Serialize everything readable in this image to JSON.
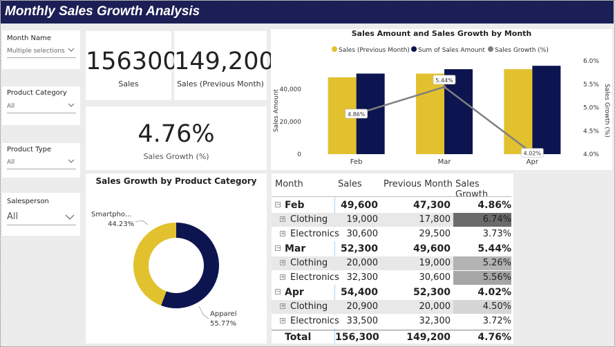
{
  "title": "Monthly Sales Growth Analysis",
  "slicers": [
    {
      "label": "Month Name",
      "value": "Multiple selections"
    },
    {
      "label": "Product Category",
      "value": "All"
    },
    {
      "label": "Product Type",
      "value": "All"
    },
    {
      "label": "Salesperson",
      "value": "All"
    }
  ],
  "kpis": {
    "sales": {
      "value": "156300",
      "label": "Sales"
    },
    "prev": {
      "value": "149,200",
      "label": "Sales (Previous Month)"
    },
    "growth": {
      "value": "4.76%",
      "label": "Sales Growth (%)"
    }
  },
  "combo": {
    "title": "Sales Amount and Sales Growth by Month",
    "legend": [
      "Sales (Previous Month)",
      "Sum of Sales Amount",
      "Sales Growth (%)"
    ],
    "ylabel": "Sales Amount",
    "y2label": "Sales Growth (%)",
    "yticks": [
      "0",
      "20,000",
      "40,000"
    ],
    "y2ticks": [
      "4.0%",
      "4.5%",
      "5.0%",
      "5.5%",
      "6.0%"
    ],
    "colors": {
      "prev": "#e2c12f",
      "sales": "#0d1550",
      "growth": "#7f7f7f"
    }
  },
  "donut": {
    "title": "Sales Growth by Product Category",
    "slices": [
      {
        "name": "Smartpho...",
        "pct": "44.23%",
        "value": 44.23,
        "color": "#e2c12f"
      },
      {
        "name": "Apparel",
        "pct": "55.77%",
        "value": 55.77,
        "color": "#0d1550"
      }
    ]
  },
  "table": {
    "headers": [
      "Month",
      "Sales",
      "Previous Month",
      "Sales Growth"
    ],
    "groups": [
      {
        "month": "Feb",
        "sales": "49,600",
        "prev": "47,300",
        "growth": "4.86%",
        "rows": [
          {
            "name": "Clothing",
            "sales": "19,000",
            "prev": "17,800",
            "growth": "6.74%",
            "bg": "#6b6b6b"
          },
          {
            "name": "Electronics",
            "sales": "30,600",
            "prev": "29,500",
            "growth": "3.73%",
            "bg": ""
          }
        ]
      },
      {
        "month": "Mar",
        "sales": "52,300",
        "prev": "49,600",
        "growth": "5.44%",
        "rows": [
          {
            "name": "Clothing",
            "sales": "20,000",
            "prev": "19,000",
            "growth": "5.26%",
            "bg": "#b3b3b3"
          },
          {
            "name": "Electronics",
            "sales": "32,300",
            "prev": "30,600",
            "growth": "5.56%",
            "bg": "#a6a6a6"
          }
        ]
      },
      {
        "month": "Apr",
        "sales": "54,400",
        "prev": "52,300",
        "growth": "4.02%",
        "rows": [
          {
            "name": "Clothing",
            "sales": "20,900",
            "prev": "20,000",
            "growth": "4.50%",
            "bg": "#d6d6d6"
          },
          {
            "name": "Electronics",
            "sales": "33,500",
            "prev": "32,300",
            "growth": "3.72%",
            "bg": ""
          }
        ]
      }
    ],
    "total": {
      "label": "Total",
      "sales": "156,300",
      "prev": "149,200",
      "growth": "4.76%"
    }
  },
  "chart_data": {
    "type": "bar",
    "title": "Sales Amount and Sales Growth by Month",
    "categories": [
      "Feb",
      "Mar",
      "Apr"
    ],
    "series": [
      {
        "name": "Sales (Previous Month)",
        "values": [
          47300,
          49600,
          52300
        ]
      },
      {
        "name": "Sum of Sales Amount",
        "values": [
          49600,
          52300,
          54400
        ]
      },
      {
        "name": "Sales Growth (%)",
        "type": "line",
        "axis": "secondary",
        "values": [
          4.86,
          5.44,
          4.02
        ],
        "labels": [
          "4.86%",
          "5.44%",
          "4.02%"
        ]
      }
    ],
    "ylabel": "Sales Amount",
    "y2label": "Sales Growth (%)",
    "ylim": [
      0,
      60000
    ],
    "y2lim": [
      4.0,
      6.0
    ]
  }
}
